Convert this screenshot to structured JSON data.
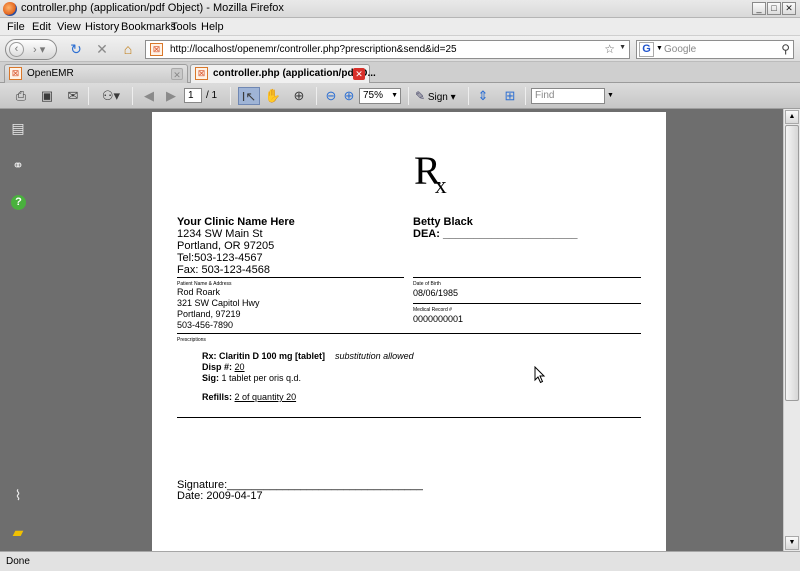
{
  "window": {
    "title": "controller.php (application/pdf Object) - Mozilla Firefox"
  },
  "menu": [
    "File",
    "Edit",
    "View",
    "History",
    "Bookmarks",
    "Tools",
    "Help"
  ],
  "nav": {
    "url": "http://localhost/openemr/controller.php?prescription&send&id=25",
    "search_placeholder": "Google"
  },
  "tabs": [
    {
      "label": "OpenEMR",
      "active": false
    },
    {
      "label": "controller.php (application/pdf O...",
      "active": true
    }
  ],
  "pdf_toolbar": {
    "page_current": "1",
    "page_total": "/ 1",
    "zoom": "75%",
    "sign_label": "Sign",
    "find_placeholder": "Find"
  },
  "document": {
    "rx_symbol": "R",
    "rx_sub": "x",
    "clinic": {
      "name": "Your Clinic Name Here",
      "address1": "1234 SW Main St",
      "address2": "Portland, OR 97205",
      "tel": "Tel:503-123-4567",
      "fax": "Fax: 503-123-4568"
    },
    "doctor": {
      "name": "Betty Black",
      "dea": "DEA: ______________________"
    },
    "patient_label": "Patient Name & Address",
    "patient": {
      "name": "Rod Roark",
      "address1": "321 SW Capitol Hwy",
      "address2": "Portland,  97219",
      "phone": "503-456-7890"
    },
    "dob_label": "Date of Birth",
    "dob": "08/06/1985",
    "mrn_label": "Medical Record #",
    "mrn": "0000000001",
    "prescriptions_label": "Prescriptions",
    "rx_line": "Rx: Claritin D 100 mg [tablet]",
    "substitution": "substitution allowed",
    "disp_label": "Disp #:",
    "disp_value": "20",
    "sig_label": "Sig:",
    "sig_value": "1 tablet per oris q.d.",
    "refills_label": "Refills:",
    "refills_value": "2 of quantity 20",
    "signature": "Signature:________________________________",
    "date": "Date: 2009-04-17"
  },
  "status": "Done"
}
